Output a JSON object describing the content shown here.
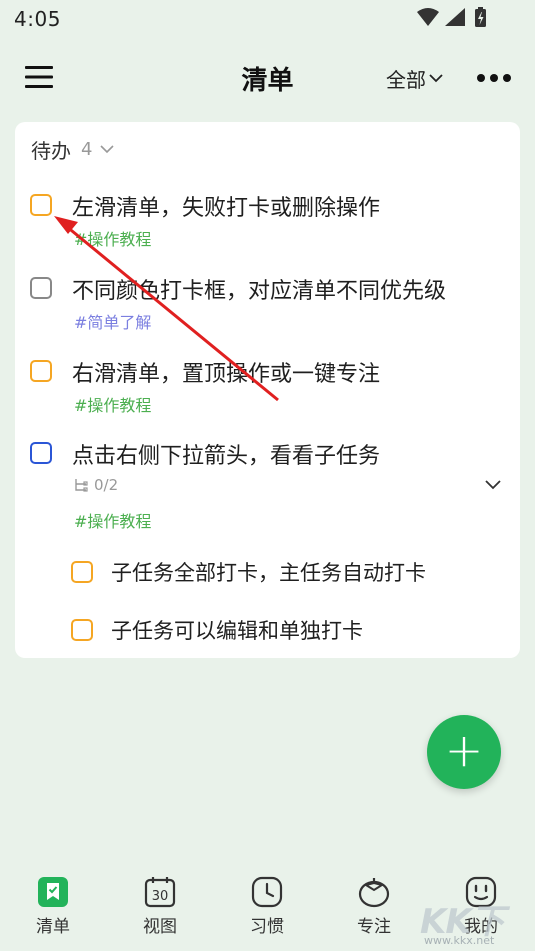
{
  "status_bar": {
    "time": "4:05",
    "icons": [
      "wifi-icon",
      "signal-icon",
      "battery-charging-icon"
    ]
  },
  "header": {
    "menu_icon": "menu-icon",
    "title": "清单",
    "filter_label": "全部",
    "more_icon": "more-icon"
  },
  "section": {
    "title": "待办",
    "count": "4"
  },
  "tasks": [
    {
      "title": "左滑清单，失败打卡或删除操作",
      "tag": "#操作教程",
      "checkbox_color": "#F5A623",
      "tag_color": "#4CAF50"
    },
    {
      "title": "不同颜色打卡框，对应清单不同优先级",
      "tag": "#简单了解",
      "checkbox_color": "#888888",
      "tag_color": "#7B7FE0"
    },
    {
      "title": "右滑清单，置顶操作或一键专注",
      "tag": "#操作教程",
      "checkbox_color": "#F5A623",
      "tag_color": "#4CAF50"
    },
    {
      "title": "点击右侧下拉箭头，看看子任务",
      "subtask_progress": "0/2",
      "tag": "#操作教程",
      "checkbox_color": "#2B56D6",
      "tag_color": "#4CAF50",
      "subtasks": [
        {
          "title": "子任务全部打卡，主任务自动打卡",
          "checkbox_color": "#F5A623"
        },
        {
          "title": "子任务可以编辑和单独打卡",
          "checkbox_color": "#F5A623"
        }
      ]
    }
  ],
  "fab": {
    "icon": "plus-icon",
    "color": "#22B35A"
  },
  "bottom_nav": [
    {
      "label": "清单",
      "icon": "checklist-icon",
      "active": true
    },
    {
      "label": "视图",
      "icon": "calendar-icon",
      "icon_text": "30"
    },
    {
      "label": "习惯",
      "icon": "clock-icon"
    },
    {
      "label": "专注",
      "icon": "tomato-icon"
    },
    {
      "label": "我的",
      "icon": "smile-icon"
    }
  ],
  "watermark": {
    "text": "KK下载",
    "url": "www.kkx.net"
  },
  "colors": {
    "background": "#E9F2EA",
    "accent": "#22B35A",
    "annotation_arrow": "#E02020"
  }
}
